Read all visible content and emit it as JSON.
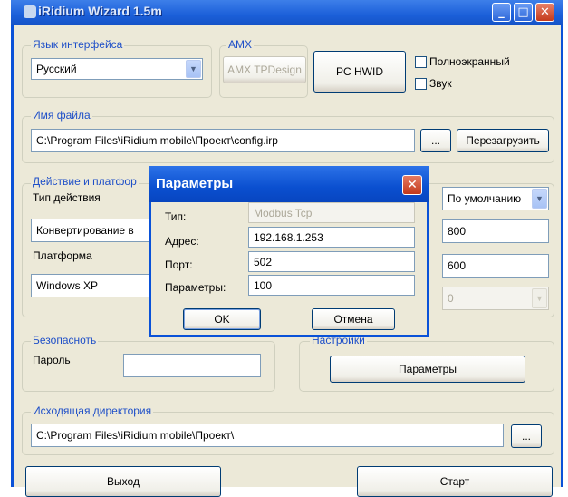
{
  "window": {
    "title": "iRidium Wizard 1.5m"
  },
  "language": {
    "group_label": "Язык интерфейса",
    "selected": "Русский"
  },
  "amx": {
    "group_label": "AMX",
    "tpdesign_label": "AMX TPDesign",
    "pc_hwid_label": "PC HWID"
  },
  "options": {
    "fullscreen_label": "Полноэкранный",
    "sound_label": "Звук"
  },
  "file": {
    "group_label": "Имя файла",
    "path": "C:\\Program Files\\iRidium mobile\\Проект\\config.irp",
    "browse_label": "...",
    "reload_label": "Перезагрузить"
  },
  "action": {
    "group_label": "Действие и платфор",
    "type_label": "Тип действия",
    "type_value": "Конвертирование в",
    "platform_label": "Платформа",
    "platform_value": "Windows XP"
  },
  "right_panel": {
    "default_value": "По умолчанию",
    "width_value": "800",
    "height_value": "600",
    "disabled_value": "0"
  },
  "security": {
    "group_label": "Безопасноть",
    "password_label": "Пароль",
    "password_value": ""
  },
  "settings": {
    "group_label": "Настройки",
    "params_button": "Параметры"
  },
  "output": {
    "group_label": "Исходящая директория",
    "path": "C:\\Program Files\\iRidium mobile\\Проект\\",
    "browse_label": "..."
  },
  "bottom": {
    "exit_label": "Выход",
    "start_label": "Старт"
  },
  "dialog": {
    "title": "Параметры",
    "type_label": "Тип:",
    "type_value": "Modbus Tcp",
    "address_label": "Адрес:",
    "address_value": "192.168.1.253",
    "port_label": "Порт:",
    "port_value": "502",
    "params_label": "Параметры:",
    "params_value": "100",
    "ok_label": "OK",
    "cancel_label": "Отмена"
  },
  "colors": {
    "titlebar": "#1b5fd9",
    "window_bg": "#ece9d8",
    "group_title": "#1e4fc8"
  }
}
